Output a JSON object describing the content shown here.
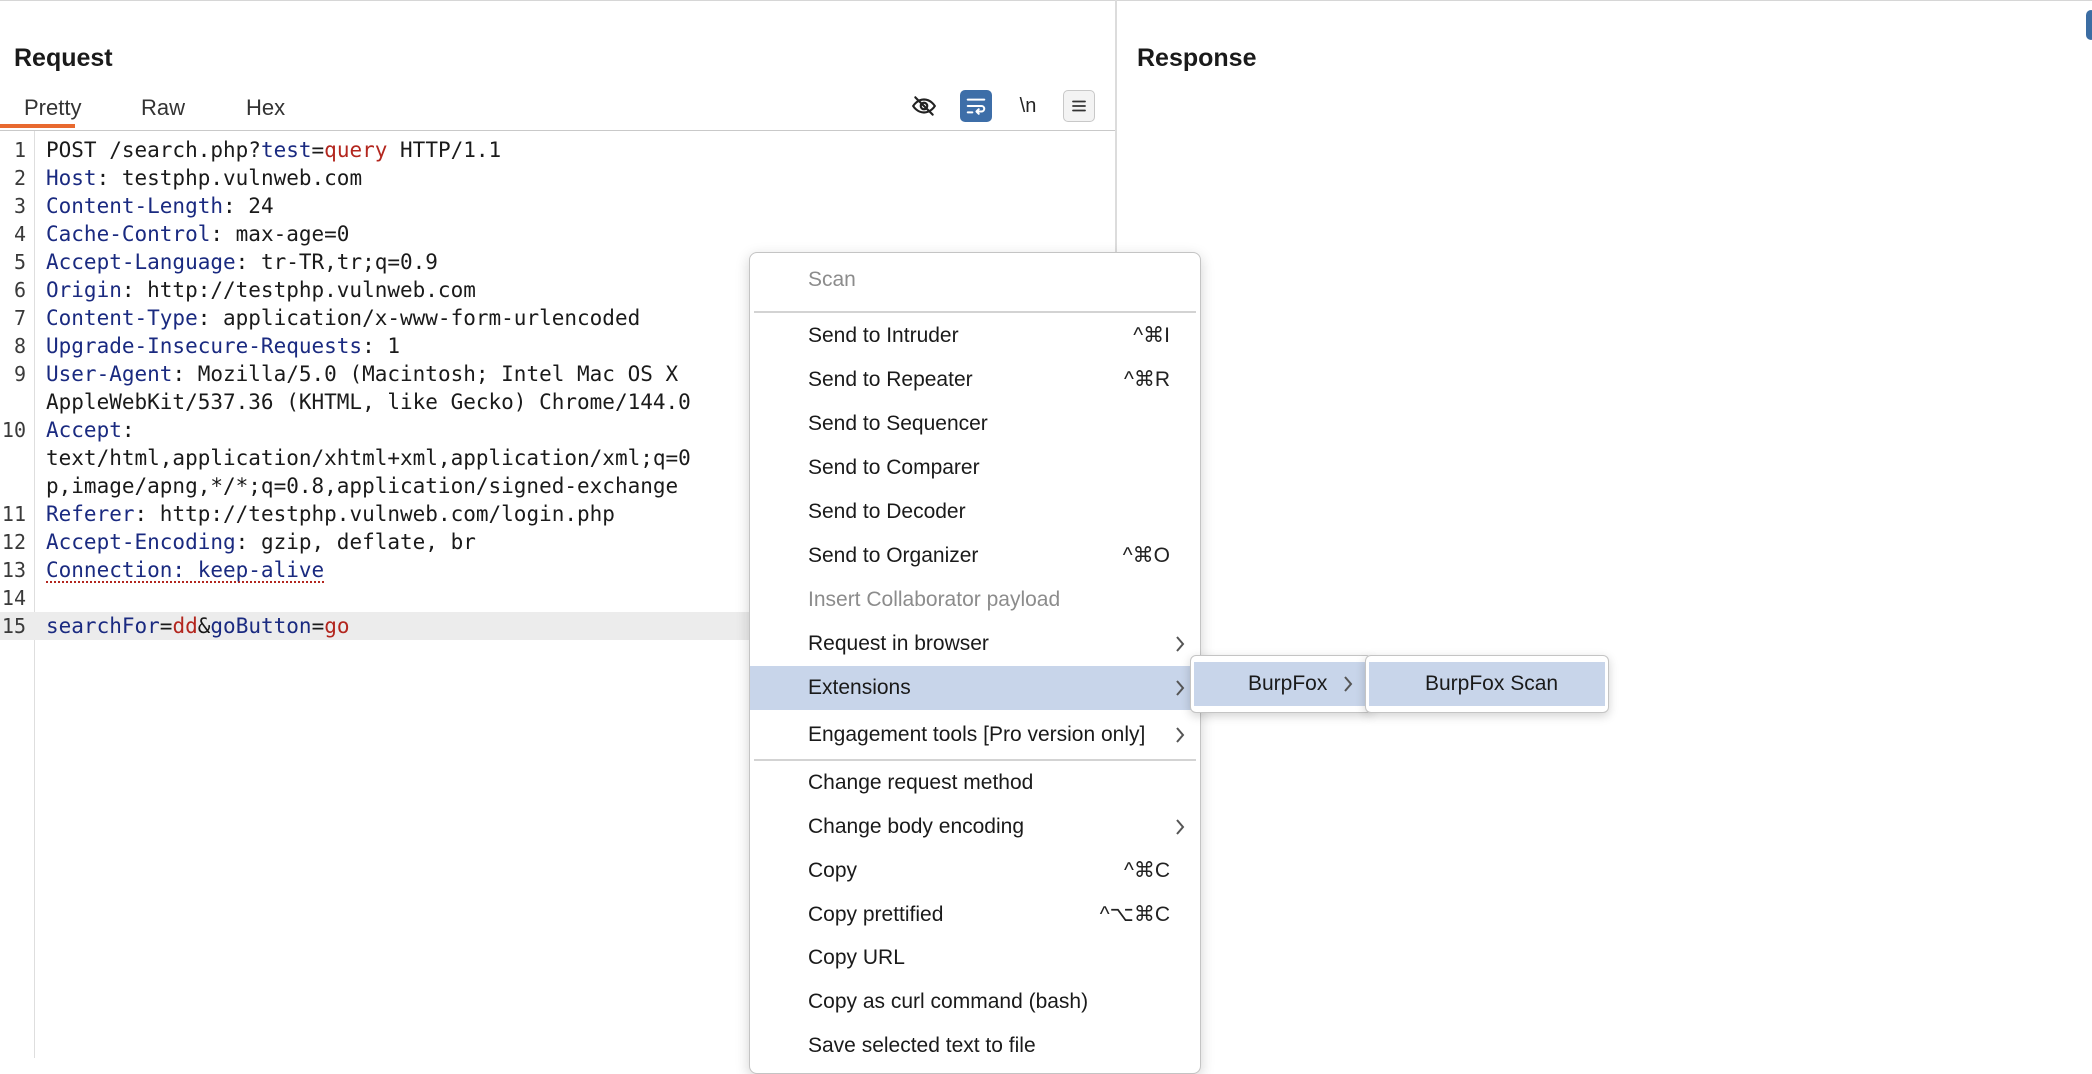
{
  "request": {
    "title": "Request",
    "tabs": [
      "Pretty",
      "Raw",
      "Hex"
    ],
    "active_tab": "Pretty",
    "toolbar": {
      "hide_icon": "eye-slash-icon",
      "wrap_icon": "word-wrap-icon",
      "newline_label": "\\n",
      "menu_icon": "hamburger-menu-icon"
    },
    "lines": [
      {
        "n": "1",
        "segs": [
          [
            "POST /search.php?",
            "val"
          ],
          [
            "test",
            "hd"
          ],
          [
            "=",
            "val"
          ],
          [
            "query",
            "red"
          ],
          [
            " HTTP/1.1",
            "val"
          ]
        ]
      },
      {
        "n": "2",
        "segs": [
          [
            "Host",
            "hd"
          ],
          [
            ": testphp.vulnweb.com",
            "val"
          ]
        ]
      },
      {
        "n": "3",
        "segs": [
          [
            "Content-Length",
            "hd"
          ],
          [
            ": 24",
            "val"
          ]
        ]
      },
      {
        "n": "4",
        "segs": [
          [
            "Cache-Control",
            "hd"
          ],
          [
            ": max-age=0",
            "val"
          ]
        ]
      },
      {
        "n": "5",
        "segs": [
          [
            "Accept-Language",
            "hd"
          ],
          [
            ": tr-TR,tr;q=0.9",
            "val"
          ]
        ]
      },
      {
        "n": "6",
        "segs": [
          [
            "Origin",
            "hd"
          ],
          [
            ": http://testphp.vulnweb.com",
            "val"
          ]
        ]
      },
      {
        "n": "7",
        "segs": [
          [
            "Content-Type",
            "hd"
          ],
          [
            ": application/x-www-form-urlencoded",
            "val"
          ]
        ]
      },
      {
        "n": "8",
        "segs": [
          [
            "Upgrade-Insecure-Requests",
            "hd"
          ],
          [
            ": 1",
            "val"
          ]
        ]
      },
      {
        "n": "9",
        "segs": [
          [
            "User-Agent",
            "hd"
          ],
          [
            ": Mozilla/5.0 (Macintosh; Intel Mac OS X",
            "val"
          ]
        ]
      },
      {
        "n": "",
        "segs": [
          [
            "AppleWebKit/537.36 (KHTML, like Gecko) Chrome/144.0",
            "val"
          ]
        ]
      },
      {
        "n": "10",
        "segs": [
          [
            "Accept",
            "hd"
          ],
          [
            ":",
            "val"
          ]
        ]
      },
      {
        "n": "",
        "segs": [
          [
            "text/html,application/xhtml+xml,application/xml;q=0",
            "val"
          ]
        ]
      },
      {
        "n": "",
        "segs": [
          [
            "p,image/apng,*/*;q=0.8,application/signed-exchange",
            "val"
          ]
        ]
      },
      {
        "n": "11",
        "segs": [
          [
            "Referer",
            "hd"
          ],
          [
            ": http://testphp.vulnweb.com/login.php",
            "val"
          ]
        ]
      },
      {
        "n": "12",
        "segs": [
          [
            "Accept-Encoding",
            "hd"
          ],
          [
            ": gzip, deflate, br",
            "val"
          ]
        ]
      },
      {
        "n": "13",
        "segs": [
          [
            "Connection: keep-alive",
            "hd dotted"
          ]
        ]
      },
      {
        "n": "14",
        "segs": []
      },
      {
        "n": "15",
        "segs": [
          [
            "searchFor",
            "hd"
          ],
          [
            "=",
            "val"
          ],
          [
            "dd",
            "red"
          ],
          [
            "&",
            "val"
          ],
          [
            "goButton",
            "hd"
          ],
          [
            "=",
            "val"
          ],
          [
            "go",
            "red"
          ]
        ],
        "highlight": true
      }
    ]
  },
  "response": {
    "title": "Response"
  },
  "context_menu": {
    "items": [
      {
        "label": "Scan",
        "disabled": true
      },
      {
        "sep": true
      },
      {
        "label": "Send to Intruder",
        "shortcut": "^⌘I"
      },
      {
        "label": "Send to Repeater",
        "shortcut": "^⌘R"
      },
      {
        "label": "Send to Sequencer"
      },
      {
        "label": "Send to Comparer"
      },
      {
        "label": "Send to Decoder"
      },
      {
        "label": "Send to Organizer",
        "shortcut": "^⌘O"
      },
      {
        "label": "Insert Collaborator payload",
        "disabled": true
      },
      {
        "label": "Request in browser",
        "submenu": true
      },
      {
        "label": "Extensions",
        "submenu": true,
        "selected": true
      },
      {
        "label": "Engagement tools [Pro version only]",
        "submenu": true
      },
      {
        "sep": true
      },
      {
        "label": "Change request method"
      },
      {
        "label": "Change body encoding",
        "submenu": true
      },
      {
        "label": "Copy",
        "shortcut": "^⌘C"
      },
      {
        "label": "Copy prettified",
        "shortcut": "^⌥⌘C"
      },
      {
        "label": "Copy URL"
      },
      {
        "label": "Copy as curl command (bash)"
      },
      {
        "label": "Save selected text to file"
      }
    ],
    "extensions_submenu": {
      "label": "BurpFox"
    },
    "burpfox_submenu": {
      "label": "BurpFox Scan"
    }
  }
}
